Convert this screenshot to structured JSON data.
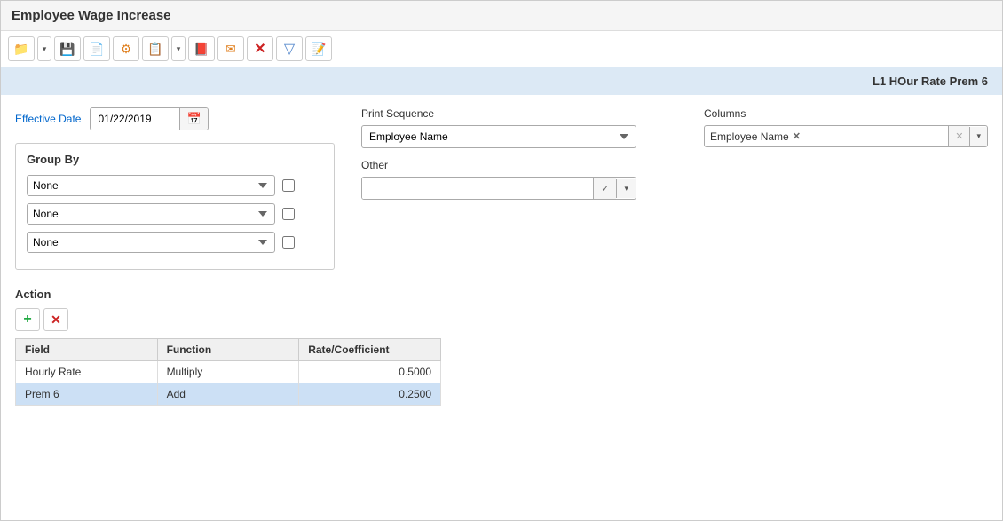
{
  "window": {
    "title": "Employee Wage Increase"
  },
  "toolbar": {
    "buttons": [
      {
        "name": "folder-btn",
        "icon": "📁",
        "class": "folder"
      },
      {
        "name": "folder-dropdown",
        "icon": "▾",
        "class": "dropdown"
      },
      {
        "name": "save-btn",
        "icon": "💾",
        "class": "save"
      },
      {
        "name": "doc-btn",
        "icon": "📄",
        "class": "doc"
      },
      {
        "name": "gear-btn",
        "icon": "⚙",
        "class": "gear"
      },
      {
        "name": "new-doc-btn",
        "icon": "📋",
        "class": "new-doc"
      },
      {
        "name": "new-doc-dropdown",
        "icon": "▾",
        "class": "dropdown"
      },
      {
        "name": "pdf-btn",
        "icon": "📕",
        "class": "pdf"
      },
      {
        "name": "email-btn",
        "icon": "✉",
        "class": "email"
      },
      {
        "name": "cancel-btn",
        "icon": "✕",
        "class": "cancel"
      },
      {
        "name": "filter-btn",
        "icon": "⊿",
        "class": "filter"
      },
      {
        "name": "sticky-btn",
        "icon": "📝",
        "class": "sticky"
      }
    ]
  },
  "section_header": {
    "text": "L1 HOur Rate Prem 6"
  },
  "effective_date": {
    "label": "Effective Date",
    "value": "01/22/2019"
  },
  "group_by": {
    "title": "Group By",
    "rows": [
      {
        "value": "None"
      },
      {
        "value": "None"
      },
      {
        "value": "None"
      }
    ]
  },
  "print_sequence": {
    "label": "Print Sequence",
    "value": "Employee Name"
  },
  "other": {
    "label": "Other",
    "value": ""
  },
  "columns": {
    "label": "Columns",
    "tags": [
      {
        "text": "Employee Name"
      }
    ]
  },
  "action": {
    "title": "Action",
    "add_label": "+",
    "remove_label": "✕",
    "table": {
      "headers": [
        "Field",
        "Function",
        "Rate/Coefficient"
      ],
      "rows": [
        {
          "field": "Hourly Rate",
          "function": "Multiply",
          "rate": "0.5000",
          "selected": false
        },
        {
          "field": "Prem 6",
          "function": "Add",
          "rate": "0.2500",
          "selected": true
        }
      ]
    }
  }
}
